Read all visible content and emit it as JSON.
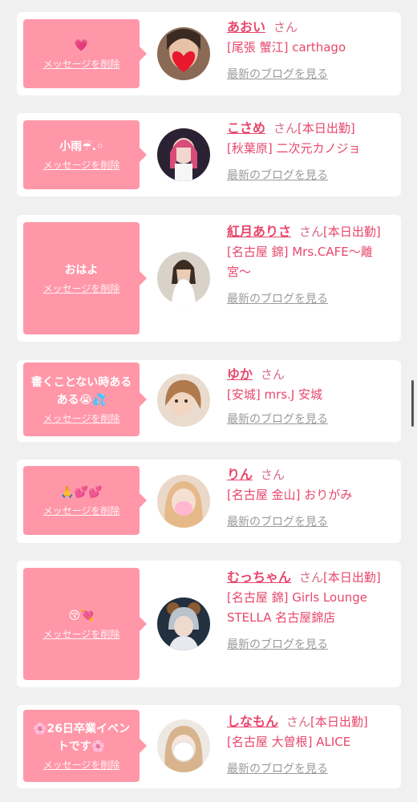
{
  "delete_label": "メッセージを削除",
  "blog_label": "最新のブログを見る",
  "san_label": "さん",
  "colors": {
    "bubble": "#ff97a9",
    "name": "#e8476c",
    "blog_link": "#9a9a9a",
    "card": "#ffffff",
    "background": "#f0f0f0"
  },
  "entries": [
    {
      "message": "💗",
      "name": "あおい",
      "suffix": "",
      "shop": "[尾張 蟹江] carthago"
    },
    {
      "message": "小雨☔.◦",
      "name": "こさめ",
      "suffix": "[本日出勤]",
      "shop": "[秋葉原] 二次元カノジョ"
    },
    {
      "message": "おはよ",
      "name": "紅月ありさ",
      "suffix": "[本日出勤]",
      "shop": "[名古屋 錦] Mrs.CAFE〜離宮〜"
    },
    {
      "message": "書くことない時あるある😭💦",
      "name": "ゆか",
      "suffix": "",
      "shop": "[安城] mrs.J 安城"
    },
    {
      "message": "🙏💕💕",
      "name": "りん",
      "suffix": "",
      "shop": "[名古屋 金山] おりがみ"
    },
    {
      "message": "😚💘",
      "name": "むっちゃん",
      "suffix": "[本日出勤]",
      "shop": "[名古屋 錦] Girls Lounge STELLA 名古屋錦店"
    },
    {
      "message": "🌸26日卒業イベントです🌸",
      "name": "しなもん",
      "suffix": "[本日出勤]",
      "shop": "[名古屋 大曽根] ALICE"
    }
  ]
}
